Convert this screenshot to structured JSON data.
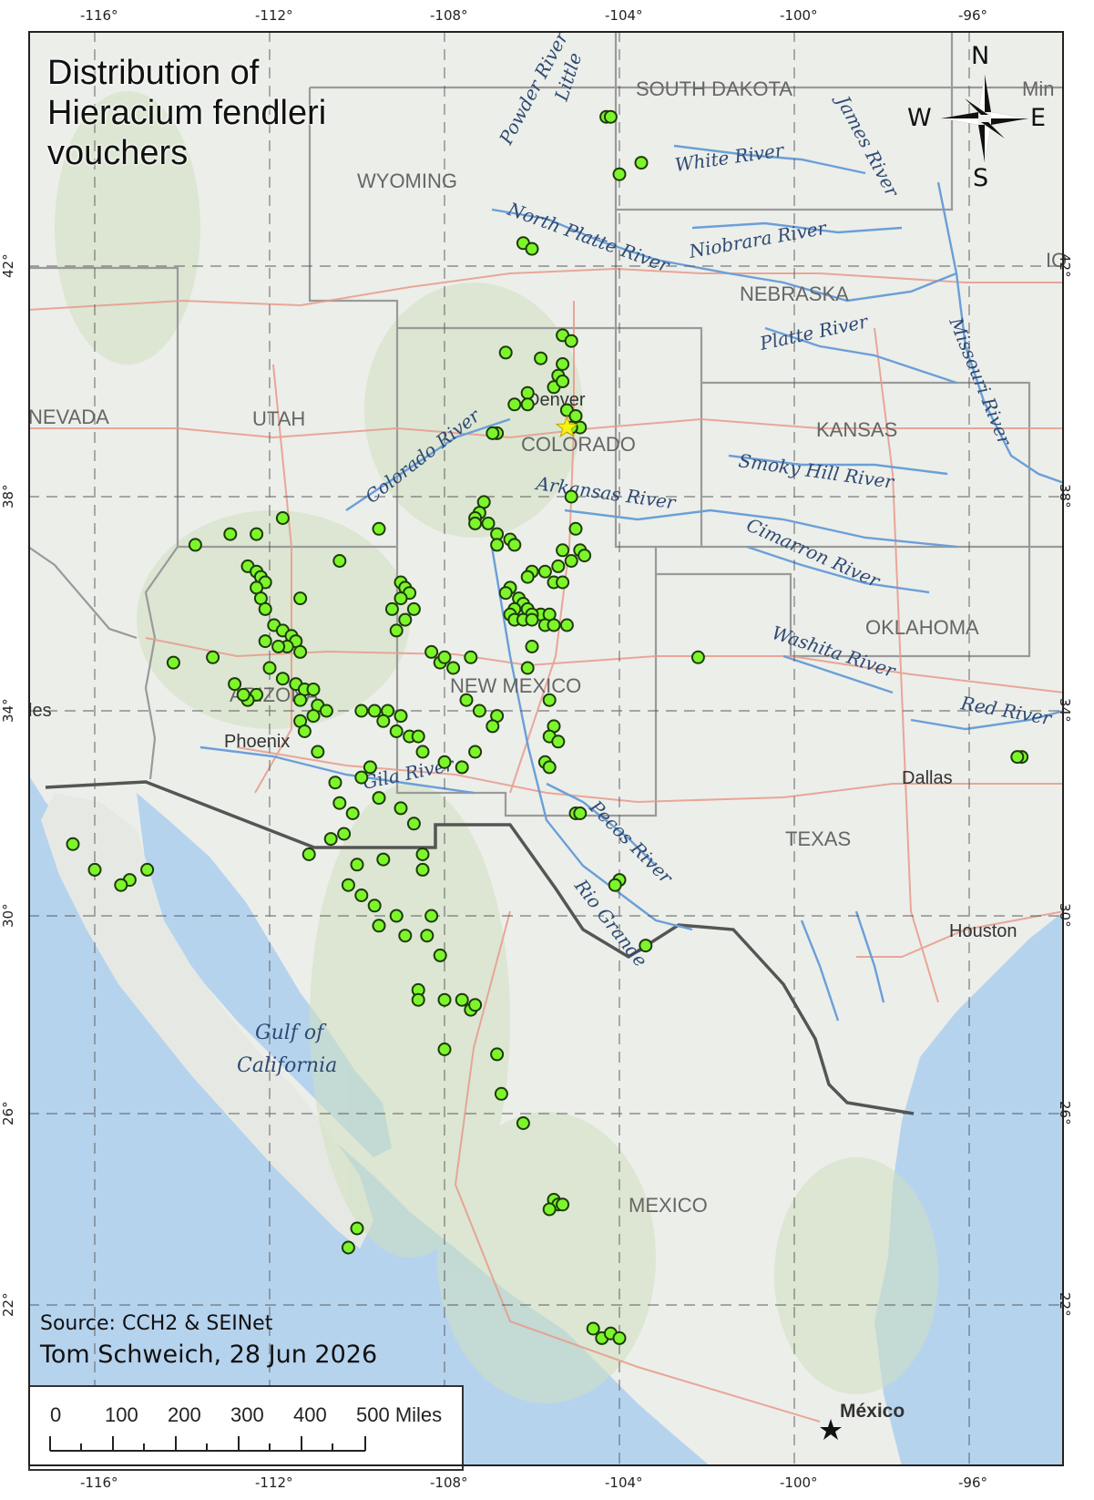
{
  "title_lines": [
    "Distribution of",
    "Hieracium fendleri",
    "vouchers"
  ],
  "source_text": "Source: CCH2 & SEINet",
  "author_text": "Tom Schweich,  28 Jun 2026",
  "scalebar": {
    "labels": [
      "0",
      "100",
      "200",
      "300",
      "400",
      "500 Miles"
    ]
  },
  "compass": {
    "n": "N",
    "s": "S",
    "e": "E",
    "w": "W"
  },
  "longitude_ticks": [
    "-116°",
    "-112°",
    "-108°",
    "-104°",
    "-100°",
    "-96°"
  ],
  "latitude_ticks": [
    "42°",
    "38°",
    "34°",
    "30°",
    "26°",
    "22°"
  ],
  "map_labels": {
    "states": [
      "SOUTH DAKOTA",
      "WYOMING",
      "NEBRASKA",
      "UTAH",
      "COLORADO",
      "KANSAS",
      "NEW MEXICO",
      "OKLAHOMA",
      "TEXAS",
      "NEVADA",
      "ARIZONA",
      "MEXICO",
      "Min",
      "IO"
    ],
    "cities": [
      "Denver",
      "Phoenix",
      "Dallas",
      "Houston",
      "México",
      "les"
    ],
    "rivers": [
      "Powder River",
      "Little",
      "White River",
      "James River",
      "North Platte River",
      "Niobrara River",
      "Platte River",
      "Missouri River",
      "Colorado River",
      "Arkansas River",
      "Smoky Hill River",
      "Cimarron River",
      "Washita River",
      "Red River",
      "Pecos River",
      "Rio Grande",
      "Gila River"
    ],
    "water": [
      "Gulf of",
      "California"
    ]
  },
  "colors": {
    "land": "#eceeea",
    "ocean": "#b6d3ee",
    "rivers": "#6b9fd8",
    "roads": "#e89a8a",
    "state_borders": "#9a9a9a",
    "intl_border": "#555555",
    "voucher_points": "#7cf52a",
    "voucher_outline": "#1d3b0a",
    "type_locality_star": "#f7f314"
  },
  "vouchers": [
    [
      -104.3,
      44.6
    ],
    [
      -104.2,
      44.6
    ],
    [
      -103.5,
      43.8
    ],
    [
      -104.0,
      43.6
    ],
    [
      -106.2,
      42.4
    ],
    [
      -106.0,
      42.3
    ],
    [
      -105.3,
      40.8
    ],
    [
      -105.1,
      40.7
    ],
    [
      -106.6,
      40.5
    ],
    [
      -105.8,
      40.4
    ],
    [
      -105.3,
      40.3
    ],
    [
      -105.4,
      40.1
    ],
    [
      -105.5,
      39.9
    ],
    [
      -105.3,
      40.0
    ],
    [
      -106.1,
      39.8
    ],
    [
      -106.4,
      39.6
    ],
    [
      -106.1,
      39.6
    ],
    [
      -105.2,
      39.5
    ],
    [
      -105.0,
      39.4
    ],
    [
      -104.9,
      39.2
    ],
    [
      -105.1,
      39.2
    ],
    [
      -106.8,
      39.1
    ],
    [
      -106.9,
      39.1
    ],
    [
      -105.1,
      38.0
    ],
    [
      -107.1,
      37.9
    ],
    [
      -107.2,
      37.7
    ],
    [
      -107.3,
      37.6
    ],
    [
      -107.0,
      37.5
    ],
    [
      -107.3,
      37.5
    ],
    [
      -106.8,
      37.3
    ],
    [
      -106.5,
      37.2
    ],
    [
      -106.4,
      37.1
    ],
    [
      -106.8,
      37.1
    ],
    [
      -105.0,
      37.4
    ],
    [
      -105.3,
      37.0
    ],
    [
      -104.9,
      37.0
    ],
    [
      -104.8,
      36.9
    ],
    [
      -105.1,
      36.8
    ],
    [
      -105.4,
      36.7
    ],
    [
      -105.7,
      36.6
    ],
    [
      -106.0,
      36.6
    ],
    [
      -106.1,
      36.5
    ],
    [
      -105.5,
      36.4
    ],
    [
      -105.3,
      36.4
    ],
    [
      -106.5,
      36.3
    ],
    [
      -106.6,
      36.2
    ],
    [
      -106.3,
      36.1
    ],
    [
      -106.2,
      36.0
    ],
    [
      -106.4,
      35.9
    ],
    [
      -106.1,
      35.9
    ],
    [
      -105.8,
      35.8
    ],
    [
      -105.6,
      35.8
    ],
    [
      -106.0,
      35.8
    ],
    [
      -106.5,
      35.8
    ],
    [
      -106.4,
      35.7
    ],
    [
      -106.2,
      35.7
    ],
    [
      -106.0,
      35.7
    ],
    [
      -105.7,
      35.6
    ],
    [
      -105.5,
      35.6
    ],
    [
      -105.2,
      35.6
    ],
    [
      -106.0,
      35.2
    ],
    [
      -106.1,
      34.8
    ],
    [
      -105.6,
      34.2
    ],
    [
      -105.5,
      33.7
    ],
    [
      -105.6,
      33.5
    ],
    [
      -105.4,
      33.4
    ],
    [
      -105.7,
      33.0
    ],
    [
      -105.6,
      32.9
    ],
    [
      -105.0,
      32.0
    ],
    [
      -104.9,
      32.0
    ],
    [
      -102.2,
      35.0
    ],
    [
      -104.0,
      30.7
    ],
    [
      -104.1,
      30.6
    ],
    [
      -103.4,
      29.4
    ],
    [
      -94.8,
      33.1
    ],
    [
      -94.9,
      33.1
    ],
    [
      -113.7,
      37.1
    ],
    [
      -112.9,
      37.3
    ],
    [
      -112.3,
      37.3
    ],
    [
      -111.7,
      37.6
    ],
    [
      -110.4,
      36.8
    ],
    [
      -109.5,
      37.4
    ],
    [
      -112.5,
      36.7
    ],
    [
      -112.3,
      36.6
    ],
    [
      -112.2,
      36.5
    ],
    [
      -112.1,
      36.4
    ],
    [
      -112.3,
      36.3
    ],
    [
      -112.2,
      36.1
    ],
    [
      -112.1,
      35.9
    ],
    [
      -111.3,
      36.1
    ],
    [
      -111.9,
      35.6
    ],
    [
      -111.7,
      35.5
    ],
    [
      -111.5,
      35.4
    ],
    [
      -111.4,
      35.3
    ],
    [
      -111.6,
      35.2
    ],
    [
      -111.8,
      35.2
    ],
    [
      -111.3,
      35.1
    ],
    [
      -112.1,
      35.3
    ],
    [
      -112.0,
      34.8
    ],
    [
      -111.7,
      34.6
    ],
    [
      -111.4,
      34.5
    ],
    [
      -111.2,
      34.4
    ],
    [
      -111.0,
      34.4
    ],
    [
      -111.3,
      34.2
    ],
    [
      -110.9,
      34.1
    ],
    [
      -110.7,
      34.0
    ],
    [
      -111.0,
      33.9
    ],
    [
      -111.3,
      33.8
    ],
    [
      -111.2,
      33.6
    ],
    [
      -112.3,
      34.3
    ],
    [
      -112.5,
      34.2
    ],
    [
      -112.6,
      34.3
    ],
    [
      -112.8,
      34.5
    ],
    [
      -113.3,
      35.0
    ],
    [
      -114.2,
      34.9
    ],
    [
      -110.9,
      33.2
    ],
    [
      -109.0,
      36.4
    ],
    [
      -108.9,
      36.3
    ],
    [
      -108.8,
      36.2
    ],
    [
      -109.0,
      36.1
    ],
    [
      -108.7,
      35.9
    ],
    [
      -109.2,
      35.9
    ],
    [
      -108.9,
      35.7
    ],
    [
      -109.1,
      35.5
    ],
    [
      -108.3,
      35.1
    ],
    [
      -108.1,
      34.9
    ],
    [
      -107.8,
      34.8
    ],
    [
      -108.0,
      35.0
    ],
    [
      -107.4,
      35.0
    ],
    [
      -107.5,
      34.2
    ],
    [
      -107.2,
      34.0
    ],
    [
      -106.8,
      33.9
    ],
    [
      -106.9,
      33.7
    ],
    [
      -109.9,
      34.0
    ],
    [
      -109.6,
      34.0
    ],
    [
      -109.3,
      34.0
    ],
    [
      -109.0,
      33.9
    ],
    [
      -109.4,
      33.8
    ],
    [
      -109.1,
      33.6
    ],
    [
      -108.8,
      33.5
    ],
    [
      -108.6,
      33.5
    ],
    [
      -108.5,
      33.2
    ],
    [
      -108.0,
      33.0
    ],
    [
      -107.6,
      32.9
    ],
    [
      -107.3,
      33.2
    ],
    [
      -109.7,
      32.9
    ],
    [
      -109.9,
      32.7
    ],
    [
      -110.5,
      32.6
    ],
    [
      -110.4,
      32.2
    ],
    [
      -110.1,
      32.0
    ],
    [
      -109.5,
      32.3
    ],
    [
      -109.0,
      32.1
    ],
    [
      -108.7,
      31.8
    ],
    [
      -110.3,
      31.6
    ],
    [
      -110.6,
      31.5
    ],
    [
      -111.1,
      31.2
    ],
    [
      -110.0,
      31.0
    ],
    [
      -109.4,
      31.1
    ],
    [
      -108.5,
      31.2
    ],
    [
      -108.5,
      30.9
    ],
    [
      -110.2,
      30.6
    ],
    [
      -109.9,
      30.4
    ],
    [
      -109.6,
      30.2
    ],
    [
      -109.1,
      30.0
    ],
    [
      -108.3,
      30.0
    ],
    [
      -109.5,
      29.8
    ],
    [
      -108.9,
      29.6
    ],
    [
      -108.4,
      29.6
    ],
    [
      -108.1,
      29.2
    ],
    [
      -108.6,
      28.5
    ],
    [
      -108.6,
      28.3
    ],
    [
      -108.0,
      28.3
    ],
    [
      -107.6,
      28.3
    ],
    [
      -107.4,
      28.1
    ],
    [
      -107.3,
      28.2
    ],
    [
      -108.0,
      27.3
    ],
    [
      -106.8,
      27.2
    ],
    [
      -106.7,
      26.4
    ],
    [
      -106.2,
      25.8
    ],
    [
      -105.5,
      24.2
    ],
    [
      -105.4,
      24.1
    ],
    [
      -105.6,
      24.0
    ],
    [
      -105.3,
      24.1
    ],
    [
      -116.5,
      31.4
    ],
    [
      -116.0,
      30.9
    ],
    [
      -115.2,
      30.7
    ],
    [
      -115.4,
      30.6
    ],
    [
      -114.8,
      30.9
    ],
    [
      -110.0,
      23.6
    ],
    [
      -110.2,
      23.2
    ],
    [
      -104.6,
      21.5
    ],
    [
      -104.4,
      21.3
    ],
    [
      -104.2,
      21.4
    ],
    [
      -104.0,
      21.3
    ]
  ],
  "type_locality": [
    -105.2,
    39.2
  ],
  "legend_cities": [
    {
      "name": "Denver",
      "lon": -104.99,
      "lat": 39.74
    },
    {
      "name": "Phoenix",
      "lon": -112.07,
      "lat": 33.45
    },
    {
      "name": "Dallas",
      "lon": -96.8,
      "lat": 32.78
    },
    {
      "name": "Houston",
      "lon": -95.37,
      "lat": 29.76
    },
    {
      "name": "México",
      "lon": -99.13,
      "lat": 19.43
    }
  ]
}
